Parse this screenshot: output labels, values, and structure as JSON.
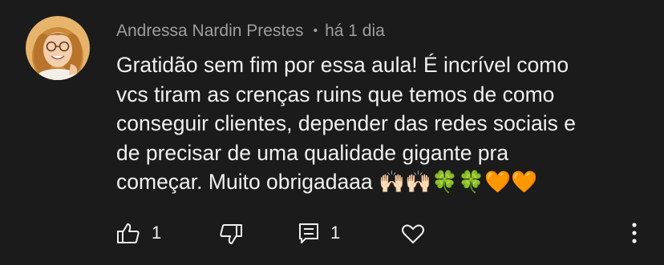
{
  "comment": {
    "author": "Andressa Nardin Prestes",
    "separator": "•",
    "timestamp": "há 1 dia",
    "text": "Gratidão sem fim por essa aula! É incrível como\nvcs tiram as crenças ruins que temos de como\nconseguir clientes, depender das redes sociais e\nde precisar de uma qualidade gigante pra\ncomeçar. Muito obrigadaaa 🙌🏻🙌🏻🍀🍀🧡🧡"
  },
  "actions": {
    "like_count": "1",
    "reply_count": "1"
  },
  "icons": {
    "like": "thumbs-up-icon",
    "dislike": "thumbs-down-icon",
    "reply": "comment-icon",
    "heart": "heart-icon",
    "more": "more-vertical-icon"
  },
  "colors": {
    "background": "#1b1b1b",
    "text": "#f1f1f1",
    "meta": "#9e9e9e"
  }
}
